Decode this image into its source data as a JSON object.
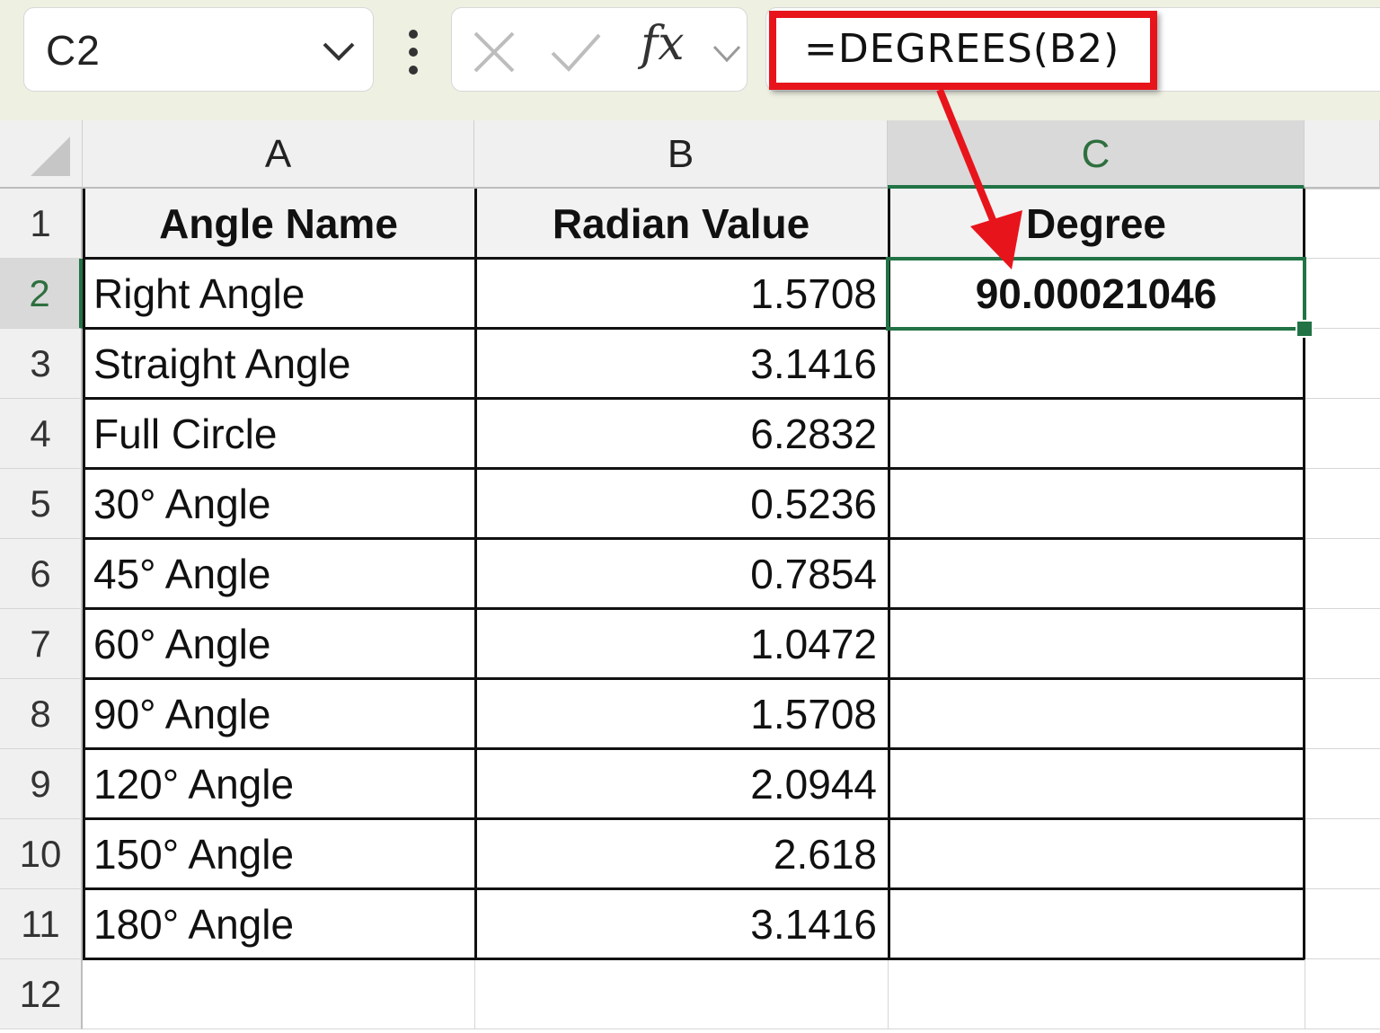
{
  "name_box": {
    "value": "C2"
  },
  "formula_bar": {
    "fx_label": "fx",
    "formula": "=DEGREES(B2)"
  },
  "columns": [
    "A",
    "B",
    "C"
  ],
  "rows": [
    "1",
    "2",
    "3",
    "4",
    "5",
    "6",
    "7",
    "8",
    "9",
    "10",
    "11",
    "12"
  ],
  "table": {
    "headers": [
      "Angle Name",
      "Radian Value",
      "Degree"
    ],
    "rows": [
      {
        "name": "Right Angle",
        "radian": "1.5708",
        "degree": "90.00021046"
      },
      {
        "name": "Straight Angle",
        "radian": "3.1416",
        "degree": ""
      },
      {
        "name": "Full Circle",
        "radian": "6.2832",
        "degree": ""
      },
      {
        "name": "30° Angle",
        "radian": "0.5236",
        "degree": ""
      },
      {
        "name": "45° Angle",
        "radian": "0.7854",
        "degree": ""
      },
      {
        "name": "60° Angle",
        "radian": "1.0472",
        "degree": ""
      },
      {
        "name": "90° Angle",
        "radian": "1.5708",
        "degree": ""
      },
      {
        "name": "120° Angle",
        "radian": "2.0944",
        "degree": ""
      },
      {
        "name": "150° Angle",
        "radian": "2.618",
        "degree": ""
      },
      {
        "name": "180° Angle",
        "radian": "3.1416",
        "degree": ""
      }
    ]
  },
  "colors": {
    "selection": "#217346",
    "highlight": "#e8141c",
    "header_fill": "#f2f2f2"
  },
  "icons": [
    "chevron-down-icon",
    "more-options-icon",
    "cancel-icon",
    "enter-icon",
    "chevron-down-icon"
  ]
}
